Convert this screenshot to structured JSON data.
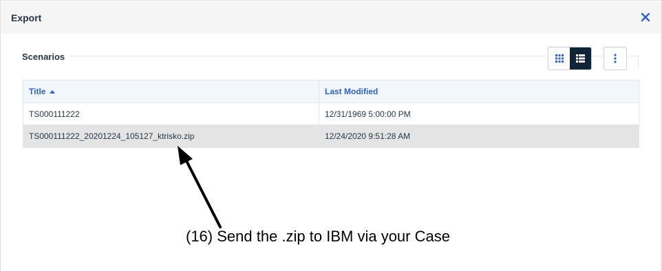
{
  "dialog": {
    "title": "Export",
    "close_icon": "close-icon"
  },
  "section": {
    "label": "Scenarios"
  },
  "toolbar": {
    "grid_view_icon": "grid-view-icon",
    "list_view_icon": "list-view-icon",
    "more_icon": "more-vertical-icon",
    "active_view": "list"
  },
  "table": {
    "columns": [
      {
        "label": "Title",
        "sort": "ascending"
      },
      {
        "label": "Last Modified"
      }
    ],
    "rows": [
      {
        "title": "TS000111222",
        "modified": "12/31/1969 5:00:00 PM",
        "selected": false
      },
      {
        "title": "TS000111222_20201224_105127_ktrisko.zip",
        "modified": "12/24/2020 9:51:28 AM",
        "selected": true
      }
    ]
  },
  "annotation": {
    "text": "(16) Send the .zip to IBM via your Case"
  },
  "colors": {
    "accent": "#2d5fd3",
    "header_bg": "#f5f5f6",
    "active_toggle": "#0f2537",
    "selected_row": "#e4e4e4"
  }
}
